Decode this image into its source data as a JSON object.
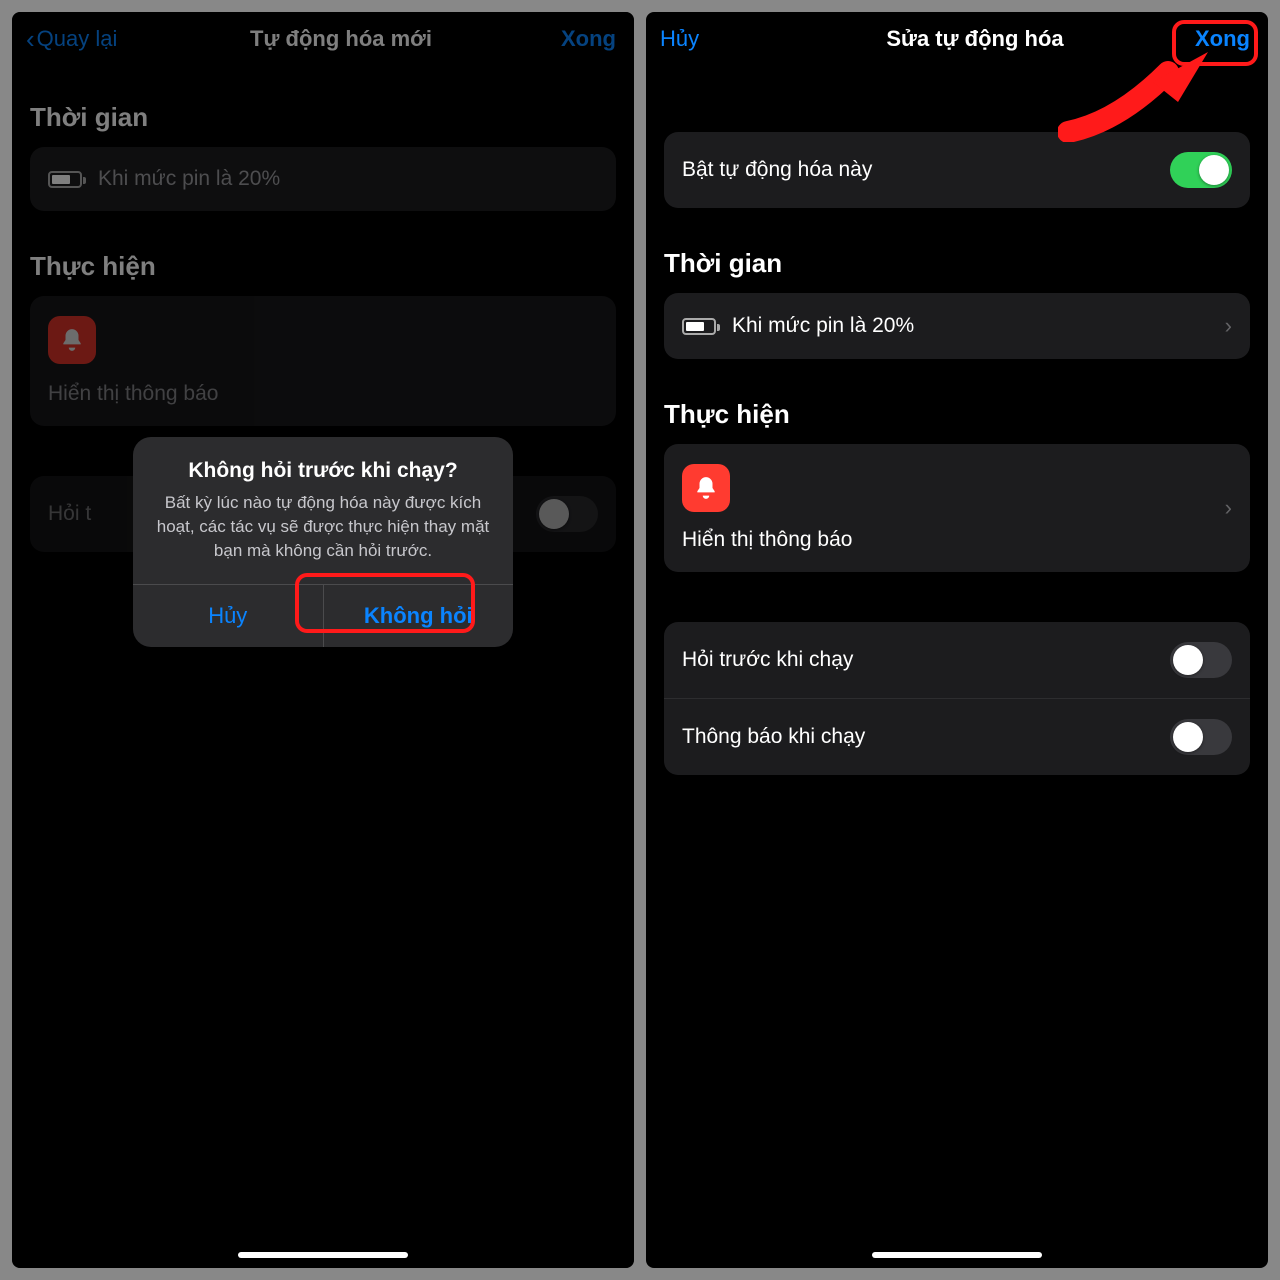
{
  "left": {
    "nav": {
      "back": "Quay lại",
      "title": "Tự động hóa mới",
      "done": "Xong"
    },
    "section_time": "Thời gian",
    "battery_row": "Khi mức pin là 20%",
    "section_do": "Thực hiện",
    "action_label": "Hiển thị thông báo",
    "ask_row": "Hỏi t",
    "alert": {
      "title": "Không hỏi trước khi chạy?",
      "message": "Bất kỳ lúc nào tự động hóa này được kích hoạt, các tác vụ sẽ được thực hiện thay mặt bạn mà không cần hỏi trước.",
      "cancel": "Hủy",
      "confirm": "Không hỏi"
    }
  },
  "right": {
    "nav": {
      "cancel": "Hủy",
      "title": "Sửa tự động hóa",
      "done": "Xong"
    },
    "enable_row": "Bật tự động hóa này",
    "section_time": "Thời gian",
    "battery_row": "Khi mức pin là 20%",
    "section_do": "Thực hiện",
    "action_label": "Hiển thị thông báo",
    "ask_before": "Hỏi trước khi chạy",
    "notify_run": "Thông báo khi chạy"
  }
}
